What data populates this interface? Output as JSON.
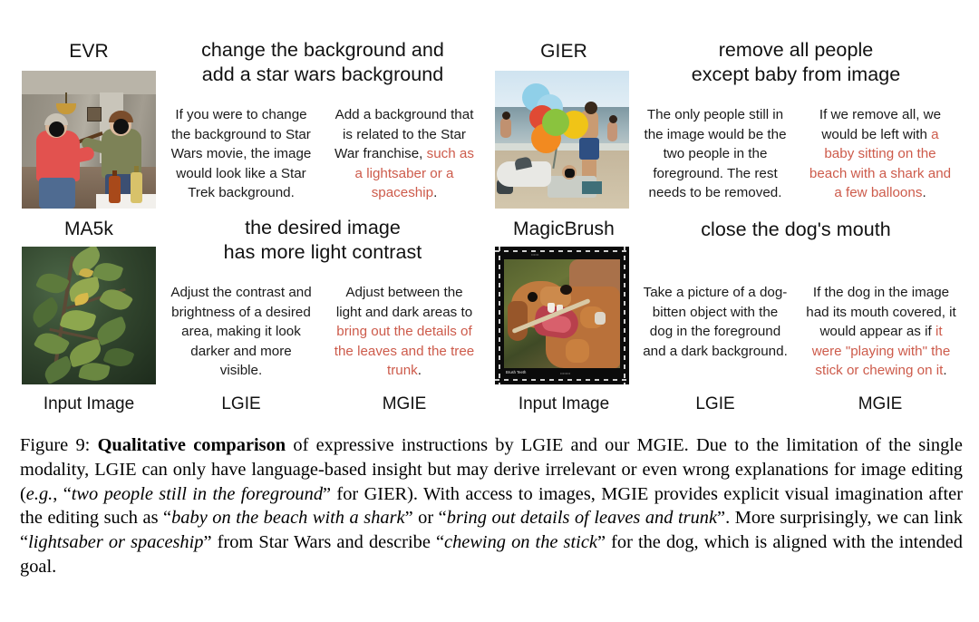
{
  "figure": {
    "columns": [
      "Input Image",
      "LGIE",
      "MGIE",
      "Input Image",
      "LGIE",
      "MGIE"
    ],
    "rows": [
      {
        "dataset": "EVR",
        "instruction_line1": "change the background and",
        "instruction_line2": "add a star wars background",
        "lgie": "If you were to change the background to Star Wars movie, the image would look like a Star Trek background.",
        "mgie_black": "Add a background that is related to the Star War franchise, ",
        "mgie_red": "such as a lightsaber or a spaceship",
        "mgie_tail": ".",
        "image_name": "evr-input-photo"
      },
      {
        "dataset": "GIER",
        "instruction_line1": "remove all people",
        "instruction_line2": "except baby from image",
        "lgie": "The only people still in the image would be the two people in the foreground. The rest needs to be removed.",
        "mgie_black": "If we remove all, we would be left with ",
        "mgie_red": "a baby sitting on the beach with a shark and a few balloons",
        "mgie_tail": ".",
        "image_name": "gier-input-photo"
      },
      {
        "dataset": "MA5k",
        "instruction_line1": "the desired image",
        "instruction_line2": "has more light contrast",
        "lgie": "Adjust the contrast and brightness of a desired area, making it look darker and more visible.",
        "mgie_black": "Adjust between the light and dark areas to ",
        "mgie_red": "bring out the details of the leaves and the tree trunk",
        "mgie_tail": ".",
        "image_name": "ma5k-input-photo"
      },
      {
        "dataset": "MagicBrush",
        "instruction_line1": "close the dog's mouth",
        "instruction_line2": "",
        "lgie": "Take a picture of a dog-bitten object with the dog in the foreground and a dark background.",
        "mgie_black": "If the dog in the image had its mouth covered, it would appear as if ",
        "mgie_red": "it were \"playing with\" the stick or chewing on it",
        "mgie_tail": ".",
        "image_name": "magicbrush-input-photo"
      }
    ],
    "colors": {
      "red_accent": "#cd5b4b",
      "text": "#111111",
      "background": "#ffffff"
    },
    "thumbnail_overlay_text": {
      "magicbrush_bottom_left": "Brush Teeth"
    }
  },
  "caption": {
    "label": "Figure 9:",
    "bold_lead": "Qualitative comparison",
    "p1": " of expressive instructions by LGIE and our MGIE. Due to the limitation of the single modality, LGIE can only have language-based insight but may derive irrelevant or even wrong explanations for image editing (",
    "i1": "e.g.",
    "p2": ", “",
    "i2": "two people still in the foreground",
    "p3": "” for GIER). With access to images, MGIE provides explicit visual imagination after the editing such as “",
    "i3": "baby on the beach with a shark",
    "p4": "” or “",
    "i4": "bring out details of leaves and trunk",
    "p5": "”. More surprisingly, we can link “",
    "i5": "lightsaber or spaceship",
    "p6": "” from Star Wars and describe “",
    "i6": "chewing on the stick",
    "p7": "” for the dog, which is aligned with the intended goal."
  }
}
